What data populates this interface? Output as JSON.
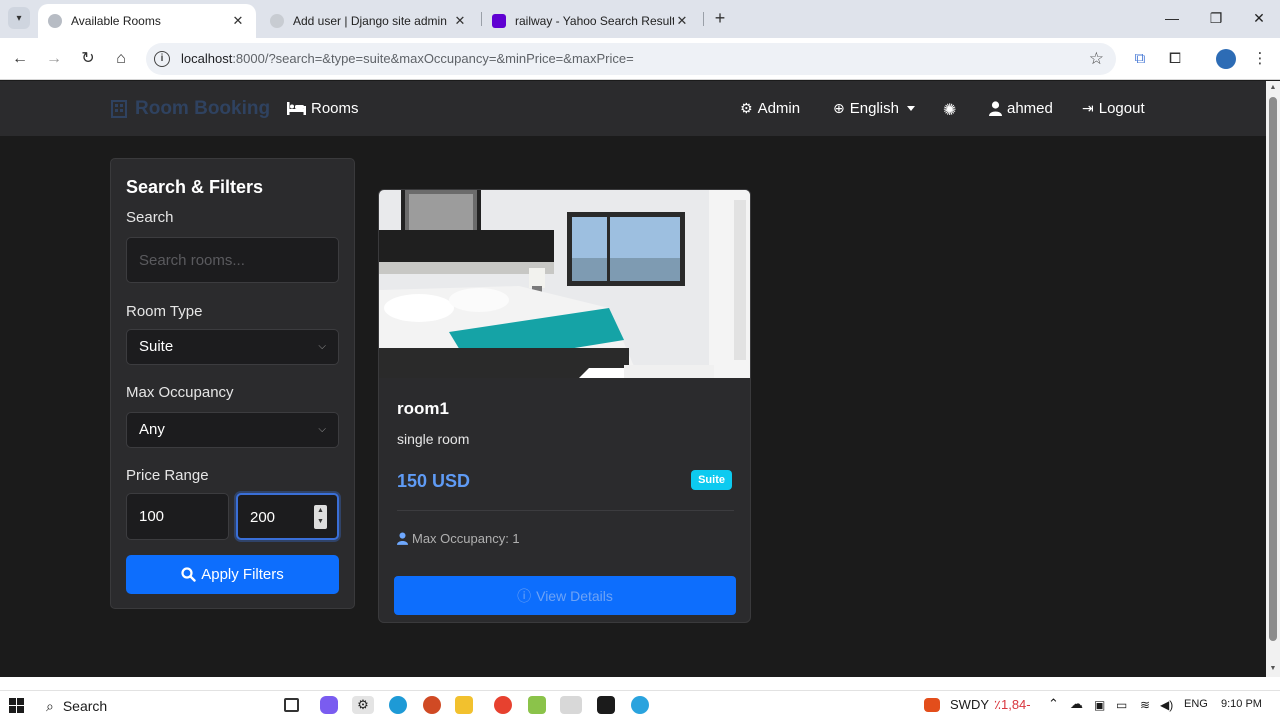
{
  "browser": {
    "tabs": [
      {
        "title": "Available Rooms",
        "active": true
      },
      {
        "title": "Add user | Django site admin",
        "active": false
      },
      {
        "title": "railway - Yahoo Search Results",
        "active": false
      }
    ],
    "url_host": "localhost",
    "url_rest": ":8000/?search=&type=suite&maxOccupancy=&minPrice=&maxPrice="
  },
  "navbar": {
    "brand": "Room Booking",
    "rooms": "Rooms",
    "admin": "Admin",
    "language": "English",
    "user": "ahmed",
    "logout": "Logout"
  },
  "filters": {
    "title": "Search & Filters",
    "search_label": "Search",
    "search_placeholder": "Search rooms...",
    "type_label": "Room Type",
    "type_value": "Suite",
    "occupancy_label": "Max Occupancy",
    "occupancy_value": "Any",
    "price_label": "Price Range",
    "min_price": "100",
    "max_price": "200",
    "apply_label": "Apply Filters"
  },
  "room": {
    "name": "room1",
    "description": "single room",
    "price": "150 USD",
    "type_badge": "Suite",
    "occupancy": "Max Occupancy: 1",
    "details_label": "View Details"
  },
  "taskbar": {
    "search": "Search",
    "ticker": "SWDY",
    "ticker_change": "٪1,84-",
    "lang": "ENG",
    "time": "9:10 PM"
  },
  "colors": {
    "primary": "#0d6efd",
    "badge": "#0dcaf0",
    "price": "#5f9bf5",
    "card_bg": "#2b2b2d",
    "page_bg": "#1b1b1b"
  }
}
